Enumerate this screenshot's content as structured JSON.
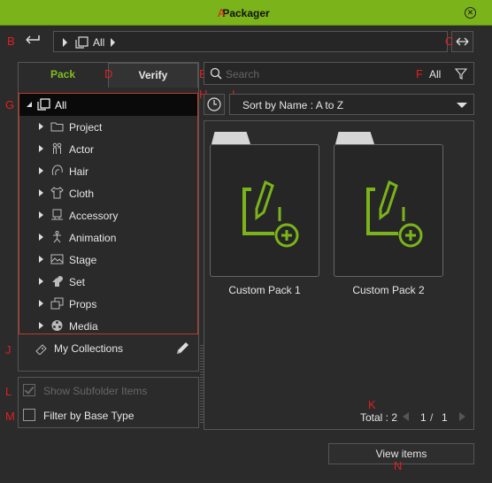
{
  "window": {
    "title": "Packager"
  },
  "markers": {
    "A": "A",
    "B": "B",
    "C": "C",
    "D": "D",
    "E": "E",
    "F": "F",
    "G": "G",
    "H": "H",
    "I": "I",
    "J": "J",
    "K": "K",
    "L": "L",
    "M": "M",
    "N": "N"
  },
  "path": {
    "current": "All"
  },
  "tabs": {
    "pack": "Pack",
    "verify": "Verify"
  },
  "search": {
    "placeholder": "Search",
    "filter_value": "All"
  },
  "sort": {
    "selected": "Sort by Name : A to Z"
  },
  "tree": {
    "root": "All",
    "items": [
      {
        "label": "Project",
        "icon": "folder-icon"
      },
      {
        "label": "Actor",
        "icon": "actor-icon"
      },
      {
        "label": "Hair",
        "icon": "hair-icon"
      },
      {
        "label": "Cloth",
        "icon": "cloth-icon"
      },
      {
        "label": "Accessory",
        "icon": "accessory-icon"
      },
      {
        "label": "Animation",
        "icon": "animation-icon"
      },
      {
        "label": "Stage",
        "icon": "stage-icon"
      },
      {
        "label": "Set",
        "icon": "set-icon"
      },
      {
        "label": "Props",
        "icon": "props-icon"
      },
      {
        "label": "Media",
        "icon": "media-icon"
      }
    ]
  },
  "collections": {
    "label": "My Collections"
  },
  "options": {
    "show_subfolder": "Show Subfolder Items",
    "filter_base": "Filter by Base Type"
  },
  "items": [
    {
      "label": "Custom Pack 1"
    },
    {
      "label": "Custom Pack 2"
    }
  ],
  "pager": {
    "total": "Total : 2",
    "current": "1",
    "sep": "/",
    "pages": "1"
  },
  "buttons": {
    "view_items": "View items"
  },
  "colors": {
    "accent": "#7ab41a",
    "marker": "#e02020"
  }
}
